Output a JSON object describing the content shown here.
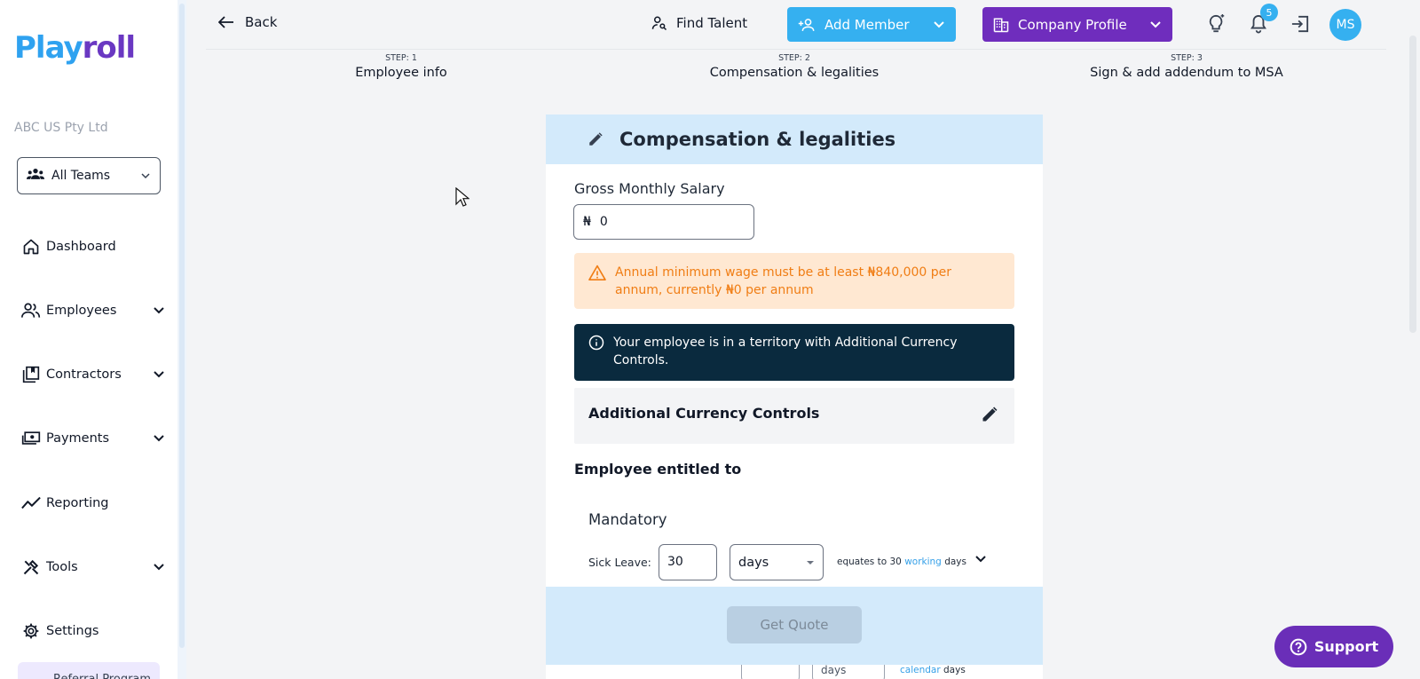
{
  "brand": {
    "logo_part1": "Play",
    "logo_part2": "roll",
    "company_name": "ABC US Pty Ltd"
  },
  "sidebar": {
    "team_select": {
      "label": "All Teams"
    },
    "items": [
      {
        "label": "Dashboard",
        "icon": "home-icon",
        "expandable": false
      },
      {
        "label": "Employees",
        "icon": "people-icon",
        "expandable": true
      },
      {
        "label": "Contractors",
        "icon": "contract-icon",
        "expandable": true
      },
      {
        "label": "Payments",
        "icon": "payments-icon",
        "expandable": true
      },
      {
        "label": "Reporting",
        "icon": "trend-icon",
        "expandable": false
      },
      {
        "label": "Tools",
        "icon": "tools-icon",
        "expandable": true
      },
      {
        "label": "Settings",
        "icon": "gear-icon",
        "expandable": false
      }
    ],
    "referral_label": "Referral Program"
  },
  "topbar": {
    "back_label": "Back",
    "find_talent_label": "Find Talent",
    "add_member_label": "Add Member",
    "company_profile_label": "Company Profile",
    "notification_count": "5",
    "avatar_initials": "MS"
  },
  "steps": [
    {
      "number": "STEP: 1",
      "label": "Employee info"
    },
    {
      "number": "STEP: 2",
      "label": "Compensation & legalities"
    },
    {
      "number": "STEP: 3",
      "label": "Sign & add addendum to MSA"
    }
  ],
  "form": {
    "title": "Compensation & legalities",
    "salary_label": "Gross Monthly Salary",
    "currency_symbol": "₦",
    "salary_value": "0",
    "warning_text": "Annual minimum wage must be at least ₦840,000 per annum, currently ₦0 per annum",
    "info_text": "Your employee is in a territory with Additional Currency Controls.",
    "additional_controls_label": "Additional Currency Controls",
    "entitled_label": "Employee entitled to",
    "mandatory_label": "Mandatory",
    "sick_leave": {
      "label": "Sick Leave:",
      "value": "30",
      "unit": "days",
      "equates_prefix": "equates to 30",
      "equates_highlight": "working",
      "equates_suffix": "days"
    },
    "next_row": {
      "unit": "days",
      "highlight": "calendar",
      "suffix": "days"
    },
    "get_quote_label": "Get Quote"
  },
  "support_label": "Support",
  "colors": {
    "brand_blue": "#35b0f0",
    "brand_purple": "#6f2dbd",
    "header_blue": "#d3eafb",
    "warning_bg": "#ffe8d2",
    "warning_text": "#f07d14",
    "info_bg": "#0a2a3e"
  }
}
